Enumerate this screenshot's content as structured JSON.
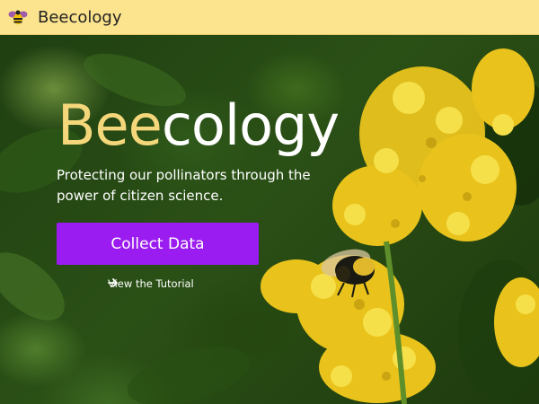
{
  "header": {
    "brand": "Beecology",
    "logo_icon": "bee-icon"
  },
  "hero": {
    "title_part1": "Bee",
    "title_part2": "cology",
    "tagline": "Protecting our pollinators through the power of citizen science.",
    "cta_label": "Collect Data",
    "tutorial_link": "View the Tutorial",
    "tutorial_icon": "arrow-right-icon"
  },
  "colors": {
    "header_bg": "#fce38e",
    "title_accent": "#f4d77a",
    "cta_bg": "#9a1cf0"
  }
}
